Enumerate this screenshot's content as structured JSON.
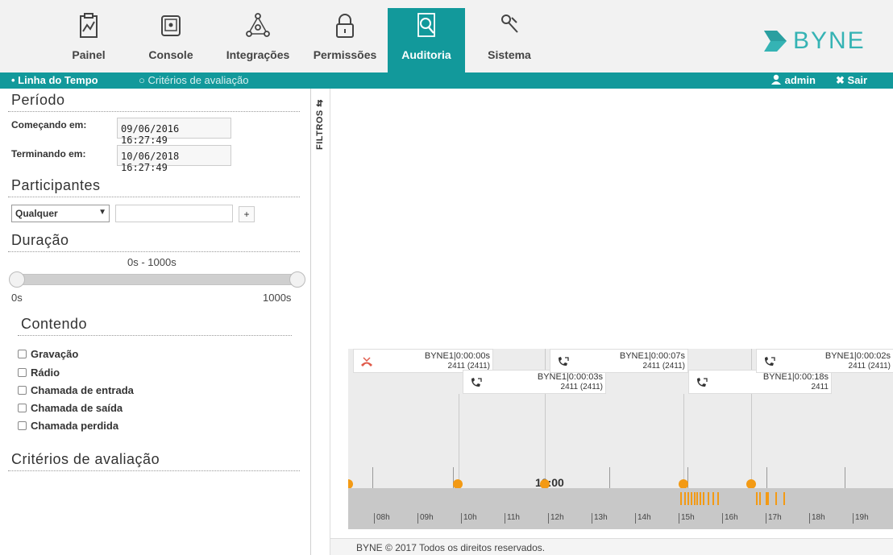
{
  "nav": {
    "items": [
      {
        "label": "Painel",
        "icon": "chart-clipboard-icon"
      },
      {
        "label": "Console",
        "icon": "console-icon"
      },
      {
        "label": "Integrações",
        "icon": "network-icon"
      },
      {
        "label": "Permissões",
        "icon": "lock-icon"
      },
      {
        "label": "Auditoria",
        "icon": "audit-search-icon"
      },
      {
        "label": "Sistema",
        "icon": "wrench-icon"
      }
    ],
    "active": "Auditoria",
    "brand": "BYNE",
    "accent_color": "#12999b"
  },
  "subnav": {
    "timeline": "• Linha do Tempo",
    "criteria": "○ Critérios de avaliação",
    "user": "admin",
    "logout": "Sair"
  },
  "filters": {
    "periodo_title": "Período",
    "start_label": "Começando em:",
    "start_value": "09/06/2016 16:27:49",
    "end_label": "Terminando em:",
    "end_value": "10/06/2018 16:27:49",
    "participantes_title": "Participantes",
    "participant_select": "Qualquer",
    "add_label": "+",
    "duracao_title": "Duração",
    "duration_range": "0s - 1000s",
    "min_label": "0s",
    "max_label": "1000s",
    "contendo_title": "Contendo",
    "options": [
      "Gravação",
      "Rádio",
      "Chamada de entrada",
      "Chamada de saída",
      "Chamada perdida"
    ],
    "criterios_title": "Critérios de avaliação",
    "tab_label": "FILTROS"
  },
  "timeline": {
    "events": [
      {
        "title": "BYNE1|0:00:00s",
        "sub": "2411 (2411)",
        "icon": "missed-call-icon"
      },
      {
        "title": "BYNE1|0:00:03s",
        "sub": "2411 (2411)",
        "icon": "incoming-call-icon"
      },
      {
        "title": "BYNE1|0:00:07s",
        "sub": "2411 (2411)",
        "icon": "incoming-call-icon"
      },
      {
        "title": "BYNE1|0:00:18s",
        "sub": "2411",
        "icon": "incoming-call-icon"
      },
      {
        "title": "BYNE1|0:00:02s",
        "sub": "2411 (2411)",
        "icon": "incoming-call-icon"
      }
    ],
    "now_label": "12:00",
    "hours": [
      "08h",
      "09h",
      "10h",
      "11h",
      "12h",
      "13h",
      "14h",
      "15h",
      "16h",
      "17h",
      "18h",
      "19h"
    ],
    "event_color": "#f39a14"
  },
  "footer": {
    "text": "BYNE © 2017 Todos os direitos reservados."
  }
}
